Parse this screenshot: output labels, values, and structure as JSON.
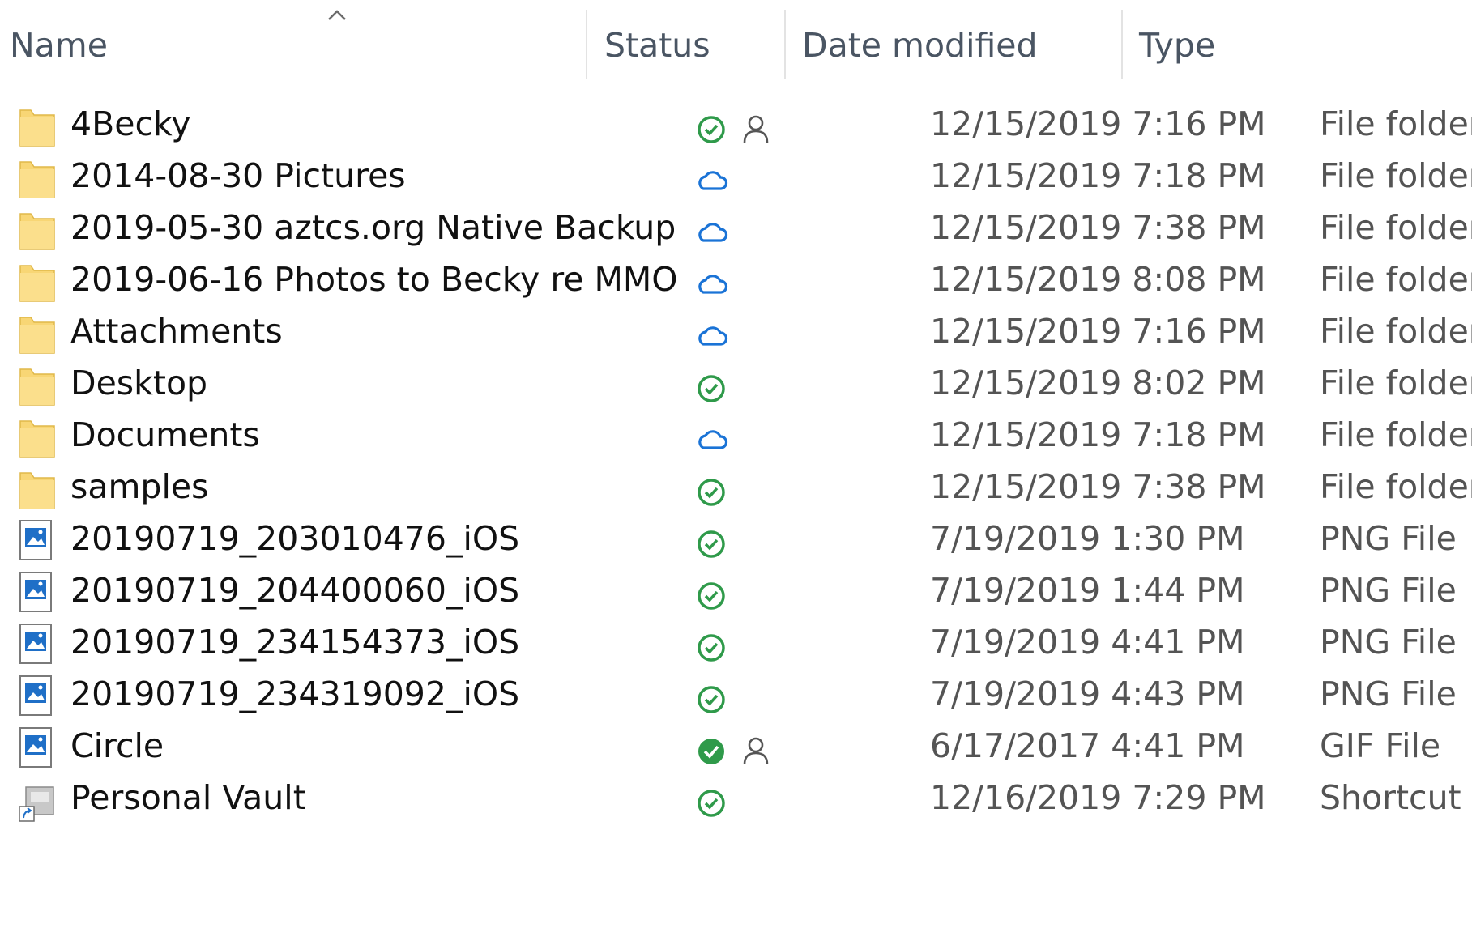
{
  "columns": {
    "name": "Name",
    "status": "Status",
    "date_modified": "Date modified",
    "type": "Type"
  },
  "sort_column": "Name",
  "colors": {
    "header_text": "#4a5563",
    "synced_green": "#2f9a4a",
    "cloud_blue": "#1a73d6",
    "folder_yellow": "#f8d675",
    "image_blue": "#1f6fc7"
  },
  "rows": [
    {
      "name": "4Becky",
      "status": "synced",
      "shared": true,
      "date": "12/15/2019 7:16 PM",
      "type": "File folder",
      "icon": "folder-icon"
    },
    {
      "name": "2014-08-30 Pictures",
      "status": "cloud",
      "shared": false,
      "date": "12/15/2019 7:18 PM",
      "type": "File folder",
      "icon": "folder-icon"
    },
    {
      "name": "2019-05-30 aztcs.org Native Backup",
      "status": "cloud",
      "shared": false,
      "date": "12/15/2019 7:38 PM",
      "type": "File folder",
      "icon": "folder-icon"
    },
    {
      "name": "2019-06-16 Photos to Becky re MMO",
      "status": "cloud",
      "shared": false,
      "date": "12/15/2019 8:08 PM",
      "type": "File folder",
      "icon": "folder-icon"
    },
    {
      "name": "Attachments",
      "status": "cloud",
      "shared": false,
      "date": "12/15/2019 7:16 PM",
      "type": "File folder",
      "icon": "folder-icon"
    },
    {
      "name": "Desktop",
      "status": "synced",
      "shared": false,
      "date": "12/15/2019 8:02 PM",
      "type": "File folder",
      "icon": "folder-icon"
    },
    {
      "name": "Documents",
      "status": "cloud",
      "shared": false,
      "date": "12/15/2019 7:18 PM",
      "type": "File folder",
      "icon": "folder-icon"
    },
    {
      "name": "samples",
      "status": "synced",
      "shared": false,
      "date": "12/15/2019 7:38 PM",
      "type": "File folder",
      "icon": "folder-icon"
    },
    {
      "name": "20190719_203010476_iOS",
      "status": "synced",
      "shared": false,
      "date": "7/19/2019 1:30 PM",
      "type": "PNG File",
      "icon": "image-file-icon"
    },
    {
      "name": "20190719_204400060_iOS",
      "status": "synced",
      "shared": false,
      "date": "7/19/2019 1:44 PM",
      "type": "PNG File",
      "icon": "image-file-icon"
    },
    {
      "name": "20190719_234154373_iOS",
      "status": "synced",
      "shared": false,
      "date": "7/19/2019 4:41 PM",
      "type": "PNG File",
      "icon": "image-file-icon"
    },
    {
      "name": "20190719_234319092_iOS",
      "status": "synced",
      "shared": false,
      "date": "7/19/2019 4:43 PM",
      "type": "PNG File",
      "icon": "image-file-icon"
    },
    {
      "name": "Circle",
      "status": "always-available",
      "shared": true,
      "date": "6/17/2017 4:41 PM",
      "type": "GIF File",
      "icon": "image-file-icon"
    },
    {
      "name": "Personal Vault",
      "status": "synced",
      "shared": false,
      "date": "12/16/2019 7:29 PM",
      "type": "Shortcut",
      "icon": "shortcut-icon"
    }
  ]
}
